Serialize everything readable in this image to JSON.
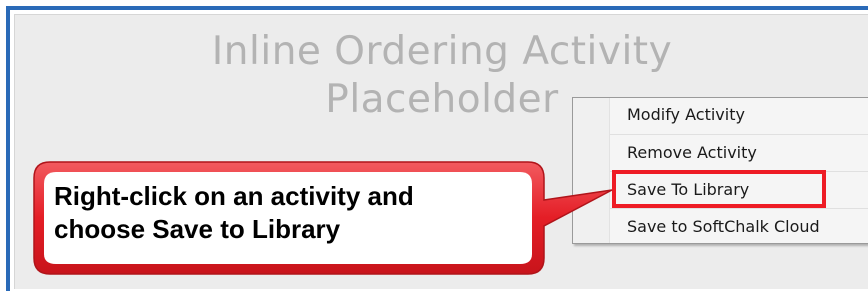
{
  "placeholder": {
    "title_line1": "Inline Ordering Activity",
    "title_line2": "Placeholder"
  },
  "context_menu": {
    "items": [
      {
        "label": "Modify Activity"
      },
      {
        "label": "Remove Activity"
      },
      {
        "label": "Save To Library"
      },
      {
        "label": "Save to SoftChalk Cloud"
      }
    ],
    "highlighted_item": "Save To Library"
  },
  "callout": {
    "line1": "Right-click on an activity and",
    "line2": "choose Save to Library"
  },
  "colors": {
    "frame_border": "#2a6ab8",
    "callout_fill": "#ec1f26",
    "callout_inner": "#ffffff",
    "highlight": "#ee1c25",
    "placeholder_text": "#b3b3b3"
  }
}
